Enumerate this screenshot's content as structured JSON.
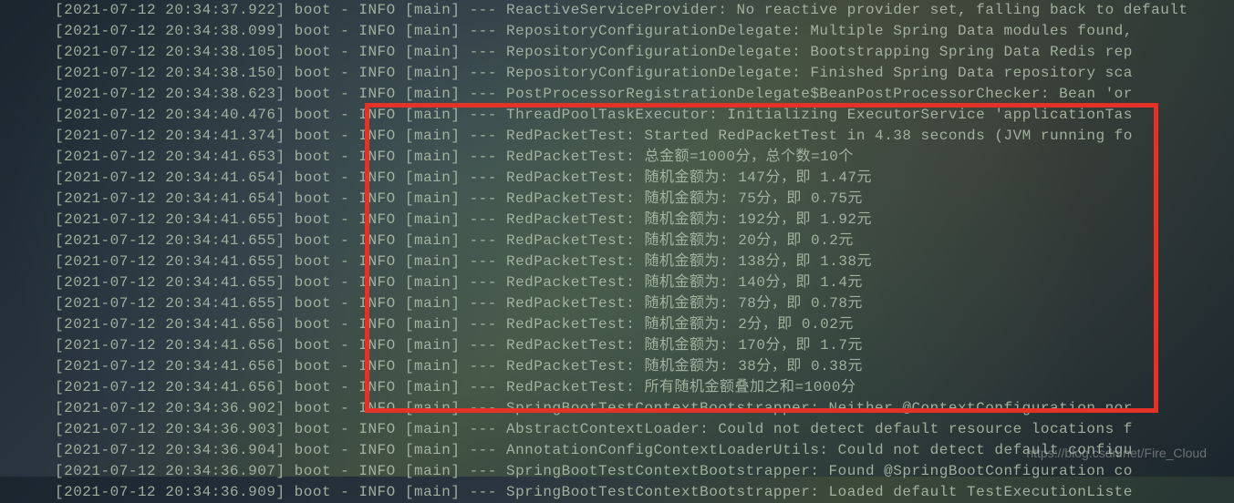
{
  "watermark": "https://blog.csdn.net/Fire_Cloud",
  "log_lines": [
    "[2021-07-12 20:34:37.922] boot -  INFO [main] --- ReactiveServiceProvider: No reactive provider set, falling back to default",
    "[2021-07-12 20:34:38.099] boot -  INFO [main] --- RepositoryConfigurationDelegate: Multiple Spring Data modules found,",
    "[2021-07-12 20:34:38.105] boot -  INFO [main] --- RepositoryConfigurationDelegate: Bootstrapping Spring Data Redis rep",
    "[2021-07-12 20:34:38.150] boot -  INFO [main] --- RepositoryConfigurationDelegate: Finished Spring Data repository sca",
    "[2021-07-12 20:34:38.623] boot -  INFO [main] --- PostProcessorRegistrationDelegate$BeanPostProcessorChecker: Bean 'or",
    "[2021-07-12 20:34:40.476] boot -  INFO [main] --- ThreadPoolTaskExecutor: Initializing ExecutorService 'applicationTas",
    "[2021-07-12 20:34:41.374] boot -  INFO [main] --- RedPacketTest: Started RedPacketTest in 4.38 seconds (JVM running fo",
    "[2021-07-12 20:34:41.653] boot -  INFO [main] --- RedPacketTest: 总金额=1000分，总个数=10个",
    "[2021-07-12 20:34:41.654] boot -  INFO [main] --- RedPacketTest: 随机金额为: 147分，即 1.47元",
    "[2021-07-12 20:34:41.654] boot -  INFO [main] --- RedPacketTest: 随机金额为: 75分，即 0.75元",
    "[2021-07-12 20:34:41.655] boot -  INFO [main] --- RedPacketTest: 随机金额为: 192分，即 1.92元",
    "[2021-07-12 20:34:41.655] boot -  INFO [main] --- RedPacketTest: 随机金额为: 20分，即 0.2元",
    "[2021-07-12 20:34:41.655] boot -  INFO [main] --- RedPacketTest: 随机金额为: 138分，即 1.38元",
    "[2021-07-12 20:34:41.655] boot -  INFO [main] --- RedPacketTest: 随机金额为: 140分，即 1.4元",
    "[2021-07-12 20:34:41.655] boot -  INFO [main] --- RedPacketTest: 随机金额为: 78分，即 0.78元",
    "[2021-07-12 20:34:41.656] boot -  INFO [main] --- RedPacketTest: 随机金额为: 2分，即 0.02元",
    "[2021-07-12 20:34:41.656] boot -  INFO [main] --- RedPacketTest: 随机金额为: 170分，即 1.7元",
    "[2021-07-12 20:34:41.656] boot -  INFO [main] --- RedPacketTest: 随机金额为: 38分，即 0.38元",
    "[2021-07-12 20:34:41.656] boot -  INFO [main] --- RedPacketTest: 所有随机金额叠加之和=1000分",
    "[2021-07-12 20:34:36.902] boot -  INFO [main] --- SpringBootTestContextBootstrapper: Neither @ContextConfiguration nor",
    "[2021-07-12 20:34:36.903] boot -  INFO [main] --- AbstractContextLoader: Could not detect default resource locations f",
    "[2021-07-12 20:34:36.904] boot -  INFO [main] --- AnnotationConfigContextLoaderUtils: Could not detect default configu",
    "[2021-07-12 20:34:36.907] boot -  INFO [main] --- SpringBootTestContextBootstrapper: Found @SpringBootConfiguration co",
    "[2021-07-12 20:34:36.909] boot -  INFO [main] --- SpringBootTestContextBootstrapper: Loaded default TestExecutionListe"
  ]
}
